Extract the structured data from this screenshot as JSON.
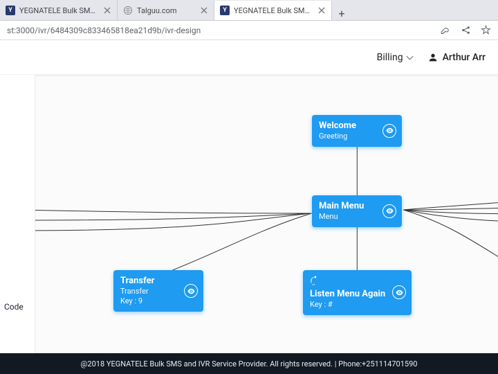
{
  "tabs": [
    {
      "title": "YEGNATELE Bulk SMS & I…",
      "favicon": "y"
    },
    {
      "title": "Talguu.com",
      "favicon": "globe"
    },
    {
      "title": "YEGNATELE Bulk SMS & I…",
      "favicon": "y",
      "active": true
    }
  ],
  "new_tab": "+",
  "url": "st:3000/ivr/6484309c833465818ea21d9b/ivr-design",
  "topbar": {
    "billing_label": "Billing",
    "user_label": "Arthur Arr"
  },
  "nodes": {
    "welcome": {
      "title": "Welcome",
      "sub": "Greeting"
    },
    "mainmenu": {
      "title": "Main Menu",
      "sub": "Menu"
    },
    "transfer": {
      "title": "Transfer",
      "sub1": "Transfer",
      "sub2": "Key : 9"
    },
    "listen": {
      "title": "Listen Menu Again",
      "sub": "Key : #"
    }
  },
  "left_rail_item": "Code",
  "footer": "@2018 YEGNATELE Bulk SMS and IVR Service Provider. All rights reserved. | Phone:+251114701590"
}
